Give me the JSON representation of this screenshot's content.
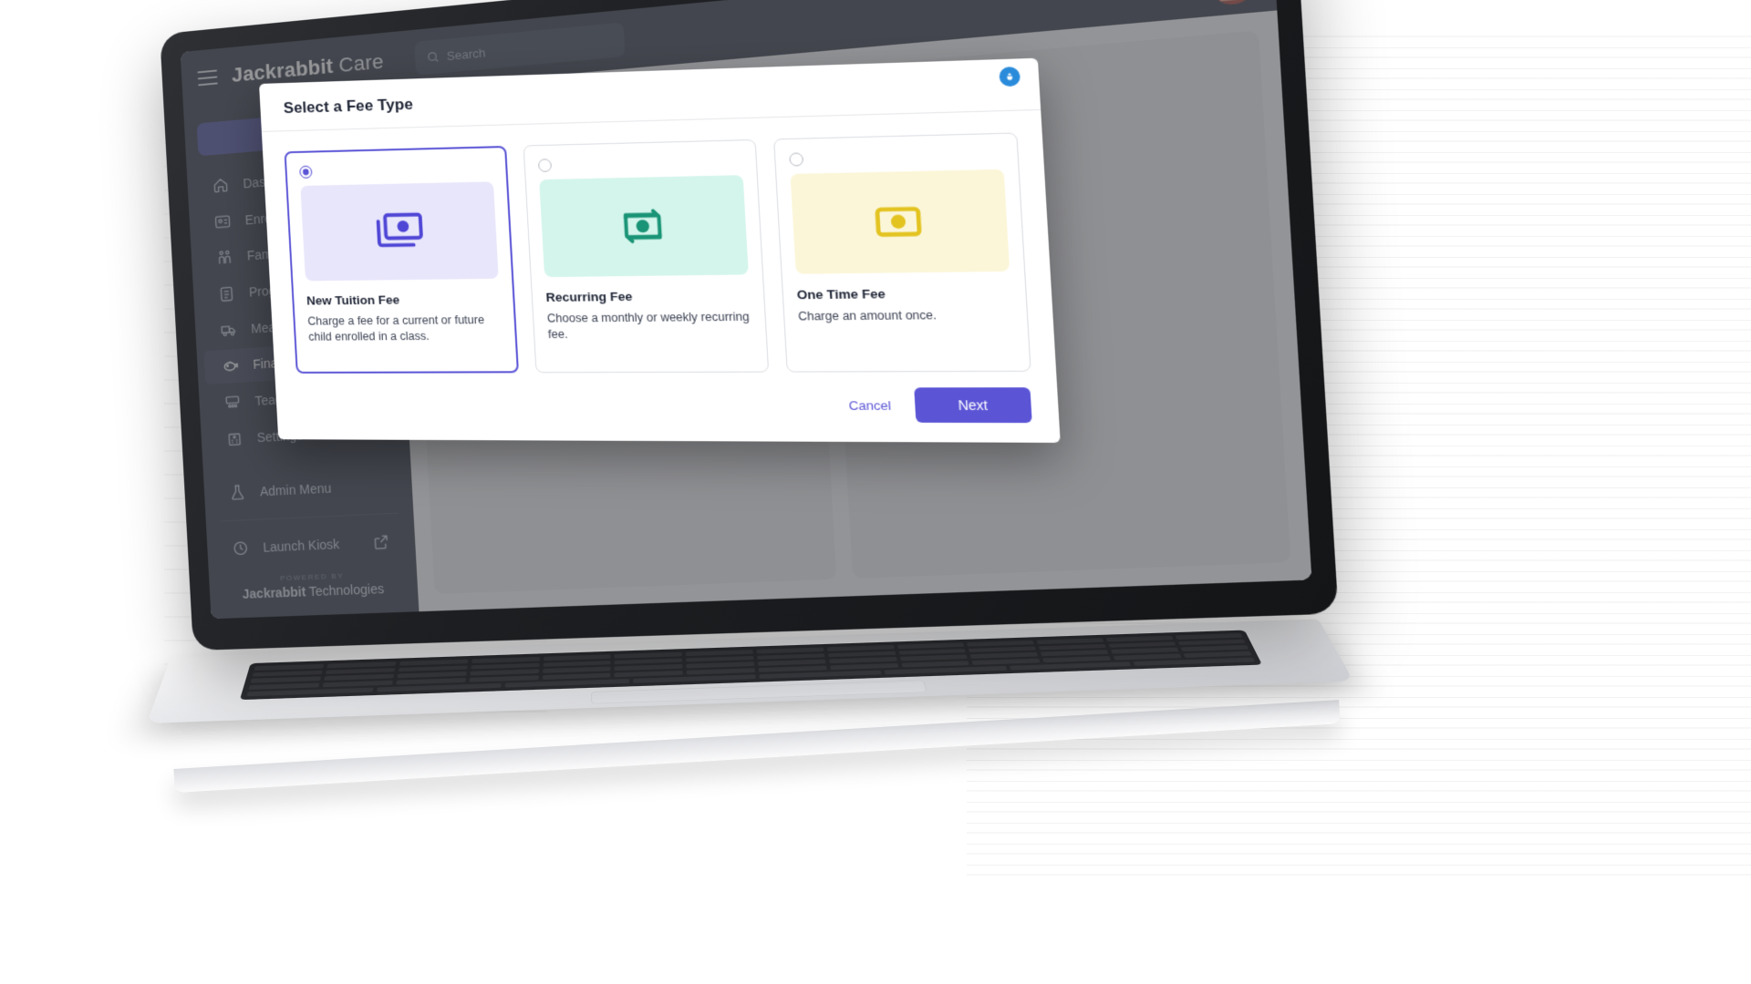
{
  "app": {
    "brand_bold": "Jackrabbit",
    "brand_light": " Care",
    "search_placeholder": "Search",
    "add_button_label": "+",
    "menu_icon": "hamburger-icon",
    "avatar_label": "user-avatar"
  },
  "sidebar": {
    "items": [
      {
        "label": "Dashboard",
        "icon": "home-icon",
        "active": false
      },
      {
        "label": "Enrollment",
        "icon": "id-card-icon",
        "active": false
      },
      {
        "label": "Families",
        "icon": "family-icon",
        "active": false
      },
      {
        "label": "Programs",
        "icon": "clipboard-list-icon",
        "active": false
      },
      {
        "label": "Meals",
        "icon": "bus-icon",
        "active": false
      },
      {
        "label": "Financials",
        "icon": "piggy-bank-icon",
        "active": true
      },
      {
        "label": "Teachers",
        "icon": "classroom-icon",
        "active": false
      },
      {
        "label": "Settings",
        "icon": "building-icon",
        "active": false
      }
    ],
    "admin_menu": {
      "label": "Admin Menu",
      "icon": "flask-icon"
    },
    "launch_kiosk": {
      "label": "Launch Kiosk",
      "icon": "clock-icon",
      "external_icon": "external-link-icon"
    },
    "footer": {
      "powered_by": "POWERED BY",
      "company_bold": "Jackrabbit",
      "company_light": " Technologies"
    }
  },
  "modal": {
    "title": "Select a Fee Type",
    "debug_icon": "bug-icon",
    "cards": [
      {
        "name": "New Tuition Fee",
        "description": "Charge a fee for a current or future child enrolled in a class.",
        "selected": true,
        "icon": "stacked-banknote-icon",
        "thumb_bg": "#e8e6fb",
        "icon_color": "#4f46d6"
      },
      {
        "name": "Recurring Fee",
        "description": "Choose a monthly or weekly recurring fee.",
        "selected": false,
        "icon": "recurring-banknote-icon",
        "thumb_bg": "#d4f5ec",
        "icon_color": "#1a9476"
      },
      {
        "name": "One Time Fee",
        "description": "Charge an amount once.",
        "selected": false,
        "icon": "banknote-icon",
        "thumb_bg": "#fbf6d8",
        "icon_color": "#e3c320"
      }
    ],
    "cancel_label": "Cancel",
    "next_label": "Next"
  },
  "colors": {
    "accent": "#5b55d6",
    "sidebar_bg": "#1d2334",
    "add_button": "#3b3e92"
  }
}
